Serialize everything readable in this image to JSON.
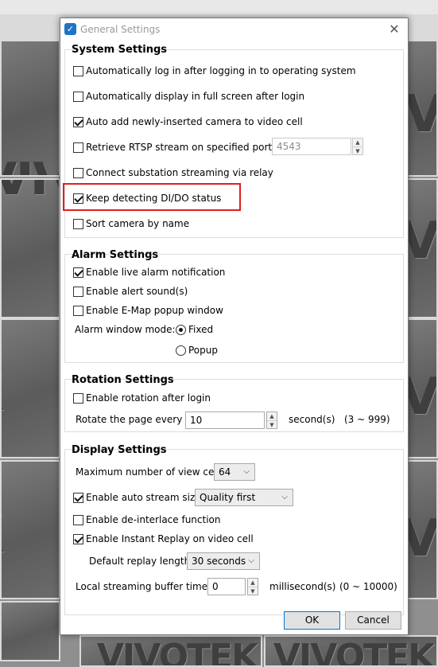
{
  "background": {
    "watermark_text": "VIVOTEK"
  },
  "dialog": {
    "title": "General Settings",
    "close_glyph": "✕",
    "app_icon_glyph": "✓"
  },
  "system_settings": {
    "title": "System Settings",
    "options": [
      {
        "label": "Automatically log in after logging in to operating system",
        "checked": false
      },
      {
        "label": "Automatically display in full screen after login",
        "checked": false
      },
      {
        "label": "Auto add newly-inserted camera to video cell",
        "checked": true
      },
      {
        "label": "Retrieve RTSP stream on specified port:",
        "checked": false
      },
      {
        "label": "Connect substation streaming via relay",
        "checked": false
      },
      {
        "label": "Keep detecting DI/DO status",
        "checked": true
      },
      {
        "label": "Sort camera by name",
        "checked": false
      }
    ],
    "rtsp_port": "4543"
  },
  "alarm_settings": {
    "title": "Alarm Settings",
    "options": [
      {
        "label": "Enable live alarm notification",
        "checked": true
      },
      {
        "label": "Enable alert sound(s)",
        "checked": false
      },
      {
        "label": "Enable E-Map popup window",
        "checked": false
      }
    ],
    "window_mode_label": "Alarm window mode:",
    "modes": [
      {
        "label": "Fixed",
        "selected": true
      },
      {
        "label": "Popup",
        "selected": false
      }
    ]
  },
  "rotation_settings": {
    "title": "Rotation Settings",
    "enable_label": "Enable rotation after login",
    "enable_checked": false,
    "rotate_label": "Rotate the page every",
    "rotate_value": "10",
    "unit_label": "second(s)",
    "range_label": "(3 ~ 999)"
  },
  "display_settings": {
    "title": "Display Settings",
    "max_cells_label": "Maximum number of view cells",
    "max_cells_value": "64",
    "auto_stream_label": "Enable auto stream size:",
    "auto_stream_checked": true,
    "auto_stream_value": "Quality first",
    "deinterlace_label": "Enable de-interlace function",
    "deinterlace_checked": false,
    "instant_replay_label": "Enable Instant Replay on video cell",
    "instant_replay_checked": true,
    "replay_length_label": "Default replay length:",
    "replay_length_value": "30 seconds",
    "buffer_label": "Local streaming buffer time:",
    "buffer_value": "0",
    "buffer_unit": "millisecond(s)",
    "buffer_range": "(0 ~ 10000)"
  },
  "buttons": {
    "ok": "OK",
    "cancel": "Cancel"
  },
  "colors": {
    "highlight": "#e01e1e",
    "accent": "#0078d7"
  }
}
